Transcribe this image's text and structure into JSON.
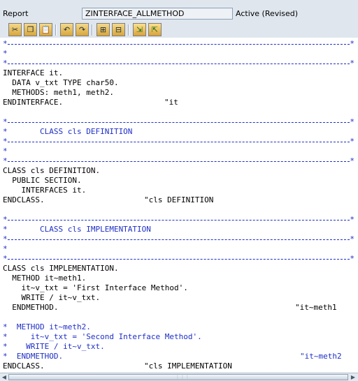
{
  "header": {
    "report_label": "Report",
    "program_name": "ZINTERFACE_ALLMETHOD",
    "status": "Active (Revised)"
  },
  "toolbar": {
    "buttons": [
      {
        "name": "cut",
        "icon": "scissors-icon",
        "glyph": "✂"
      },
      {
        "name": "copy",
        "icon": "copy-icon",
        "glyph": "❐"
      },
      {
        "name": "paste",
        "icon": "paste-icon",
        "glyph": "📋"
      },
      {
        "name": "undo",
        "icon": "undo-icon",
        "glyph": "↶"
      },
      {
        "name": "redo",
        "icon": "redo-icon",
        "glyph": "↷"
      },
      {
        "name": "find",
        "icon": "binoculars-icon",
        "glyph": "⊞"
      },
      {
        "name": "find-next",
        "icon": "binoculars-next-icon",
        "glyph": "⊟"
      },
      {
        "name": "insert-statement",
        "icon": "insert-statement-icon",
        "glyph": "⇲"
      },
      {
        "name": "pattern",
        "icon": "pattern-icon",
        "glyph": "⇱"
      }
    ]
  },
  "code": {
    "interface_decl": "INTERFACE it.",
    "data_stmt": "  DATA v_txt TYPE char50.",
    "methods_stmt": "  METHODS: meth1, meth2.",
    "endinterface": "ENDINTERFACE.",
    "endinterface_comment": "\"it",
    "star": "*",
    "def_header_comment": "*       CLASS cls DEFINITION",
    "class_def": "CLASS cls DEFINITION.",
    "public_section": "  PUBLIC SECTION.",
    "interfaces_stmt": "    INTERFACES it.",
    "endclass_def": "ENDCLASS.",
    "endclass_def_comment": "\"cls DEFINITION",
    "impl_header_comment": "*       CLASS cls IMPLEMENTATION",
    "class_impl": "CLASS cls IMPLEMENTATION.",
    "method_meth1": "  METHOD it~meth1.",
    "assign_meth1": "    it~v_txt = 'First Interface Method'.",
    "write_meth1": "    WRITE / it~v_txt.",
    "endmethod_meth1": "  ENDMETHOD.",
    "endmethod_meth1_comment": "\"it~meth1",
    "method_meth2": "*  METHOD it~meth2.",
    "assign_meth2": "*     it~v_txt = 'Second Interface Method'.",
    "write_meth2": "*    WRITE / it~v_txt.",
    "endmethod_meth2": "*  ENDMETHOD.",
    "endmethod_meth2_comment": "\"it~meth2",
    "endclass_impl": "ENDCLASS.",
    "endclass_impl_comment": "\"cls IMPLEMENTATION"
  },
  "colors": {
    "comment": "#1e2fc7",
    "code": "#000000",
    "editor_bg": "#ffffff",
    "chrome_bg": "#dfe6ee"
  }
}
